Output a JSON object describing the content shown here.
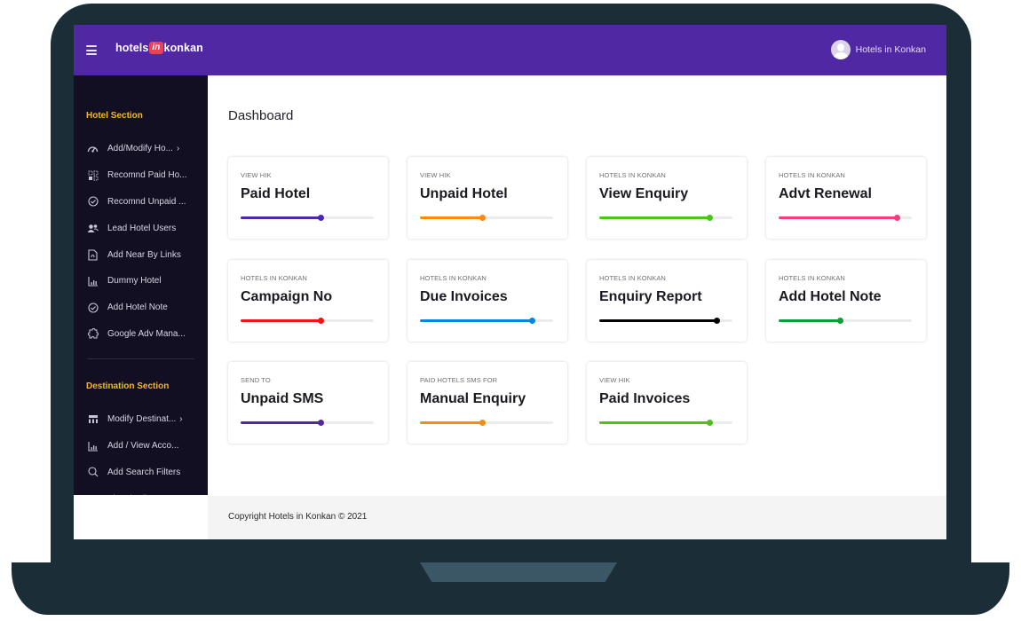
{
  "topbar": {
    "menu_icon": "hamburger-icon",
    "logo": {
      "part1": "hotels",
      "badge": "in",
      "part2": "konkan"
    },
    "user": {
      "avatar_icon": "user-avatar-icon",
      "name": "Hotels in Konkan"
    },
    "color": "#5128a4"
  },
  "sidebar": {
    "hotel_section": {
      "title": "Hotel Section",
      "items": [
        {
          "label": "Add/Modify Ho...",
          "icon": "dashboard-gauge-icon",
          "has_submenu": true
        },
        {
          "label": "Recomnd Paid Ho...",
          "icon": "grid-dots-icon",
          "has_submenu": false
        },
        {
          "label": "Recomnd Unpaid ...",
          "icon": "check-circle-icon",
          "has_submenu": false
        },
        {
          "label": "Lead Hotel Users",
          "icon": "users-icon",
          "has_submenu": false
        },
        {
          "label": "Add Near By Links",
          "icon": "file-link-icon",
          "has_submenu": false
        },
        {
          "label": "Dummy Hotel",
          "icon": "bar-chart-icon",
          "has_submenu": false
        },
        {
          "label": "Add Hotel Note",
          "icon": "check-circle-icon",
          "has_submenu": false
        },
        {
          "label": "Google Adv Mana...",
          "icon": "puzzle-icon",
          "has_submenu": false
        }
      ]
    },
    "destination_section": {
      "title": "Destination Section",
      "items": [
        {
          "label": "Modify Destinat...",
          "icon": "table-icon",
          "has_submenu": true
        },
        {
          "label": "Add / View Acco...",
          "icon": "bar-chart-icon",
          "has_submenu": false
        },
        {
          "label": "Add Search Filters",
          "icon": "search-icon",
          "has_submenu": false
        },
        {
          "label": "View / Edit Searc...",
          "icon": "eye-icon",
          "has_submenu": false
        }
      ]
    },
    "chevron": "›",
    "section_color": "#f5b921"
  },
  "main": {
    "title": "Dashboard",
    "cards": [
      {
        "kicker": "View HIK",
        "title": "Paid Hotel",
        "progress": 60,
        "color": "#5128a4"
      },
      {
        "kicker": "View HIK",
        "title": "Unpaid Hotel",
        "progress": 47,
        "color": "#f98a12"
      },
      {
        "kicker": "Hotels in Konkan",
        "title": "View Enquiry",
        "progress": 83,
        "color": "#4cc31a"
      },
      {
        "kicker": "Hotels in Konkan",
        "title": "Advt Renewal",
        "progress": 89,
        "color": "#f23d7f"
      },
      {
        "kicker": "Hotels in Konkan",
        "title": "Campaign No",
        "progress": 60,
        "color": "#f01414"
      },
      {
        "kicker": "Hotels in Konkan",
        "title": "Due Invoices",
        "progress": 84,
        "color": "#0a86d9"
      },
      {
        "kicker": "Hotels in Konkan",
        "title": "Enquiry Report",
        "progress": 88,
        "color": "#000000"
      },
      {
        "kicker": "Hotels in Konkan",
        "title": "Add Hotel Note",
        "progress": 46,
        "color": "#0f9d3a"
      },
      {
        "kicker": "Send To",
        "title": "Unpaid SMS",
        "progress": 60,
        "color": "#5128a4"
      },
      {
        "kicker": "Paid Hotels SMS For",
        "title": "Manual Enquiry",
        "progress": 47,
        "color": "#f98a12"
      },
      {
        "kicker": "View HIK",
        "title": "Paid Invoices",
        "progress": 83,
        "color": "#4cc31a"
      }
    ]
  },
  "footer": {
    "text": "Copyright Hotels in Konkan © 2021"
  }
}
